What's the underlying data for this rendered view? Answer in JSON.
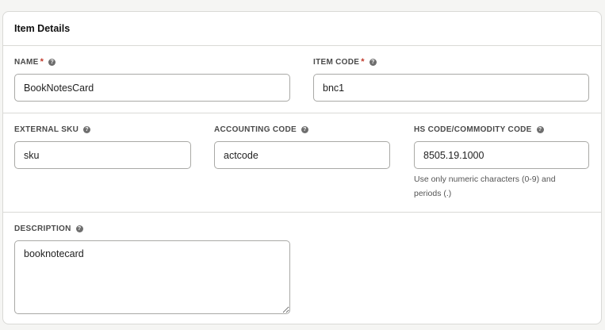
{
  "card": {
    "title": "Item Details"
  },
  "fields": {
    "name": {
      "label": "NAME",
      "required": "*",
      "value": "BookNotesCard"
    },
    "item_code": {
      "label": "ITEM CODE",
      "required": "*",
      "value": "bnc1"
    },
    "external_sku": {
      "label": "EXTERNAL SKU",
      "value": "sku"
    },
    "accounting_code": {
      "label": "ACCOUNTING CODE",
      "value": "actcode"
    },
    "hs_code": {
      "label": "HS CODE/COMMODITY CODE",
      "value": "8505.19.1000",
      "hint_line1": "Use only numeric characters (0-9) and",
      "hint_line2": "periods (.)"
    },
    "description": {
      "label": "DESCRIPTION",
      "value": "booknotecard"
    }
  },
  "icons": {
    "help": "question-circle-icon",
    "help_glyph": "?"
  },
  "colors": {
    "required": "#c0392b",
    "border": "#a9a9a6",
    "divider": "#d9d9d6"
  }
}
